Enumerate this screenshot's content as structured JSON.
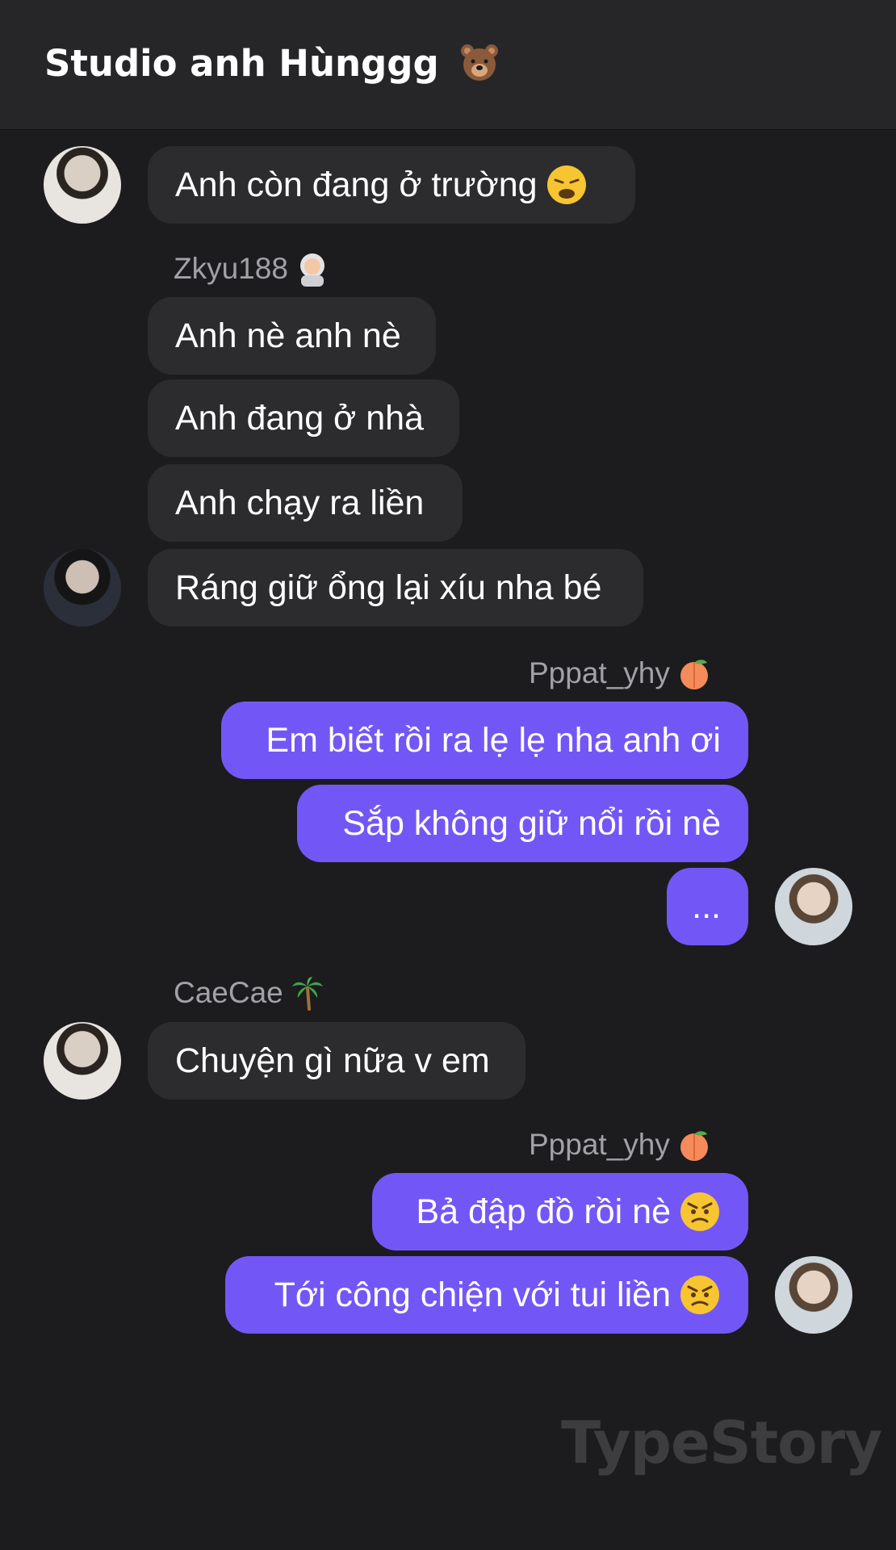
{
  "header": {
    "title": "Studio anh Hùnggg",
    "title_icon": "bear-face-icon"
  },
  "senders": {
    "zkyu": {
      "name": "Zkyu188",
      "icon": "astronaut-icon"
    },
    "pppat": {
      "name": "Pppat_yhy",
      "icon": "peach-icon"
    },
    "caecae": {
      "name": "CaeCae",
      "icon": "palm-tree-icon"
    }
  },
  "messages": {
    "m1": {
      "text": "Anh còn đang ở trường",
      "icon": "weary-face-icon"
    },
    "m2": {
      "text": "Anh nè anh nè"
    },
    "m3": {
      "text": "Anh đang ở nhà"
    },
    "m4": {
      "text": "Anh chạy ra liền"
    },
    "m5": {
      "text": "Ráng giữ ổng lại xíu nha bé"
    },
    "m6": {
      "text": "Em biết rồi ra lẹ lẹ nha anh ơi"
    },
    "m7": {
      "text": "Sắp không giữ nổi rồi nè"
    },
    "m8": {
      "text": "..."
    },
    "m9": {
      "text": "Chuyện gì nữa v em"
    },
    "m10": {
      "text": "Bả đập đồ rồi nè",
      "icon": "angry-face-icon"
    },
    "m11": {
      "text": "Tới công chiện với tui liền",
      "icon": "angry-face-icon"
    }
  },
  "watermark": "TypeStory",
  "colors": {
    "background": "#1c1c1e",
    "incoming": "#2c2c2e",
    "outgoing": "#7357f6",
    "name": "#a1a1a6"
  }
}
